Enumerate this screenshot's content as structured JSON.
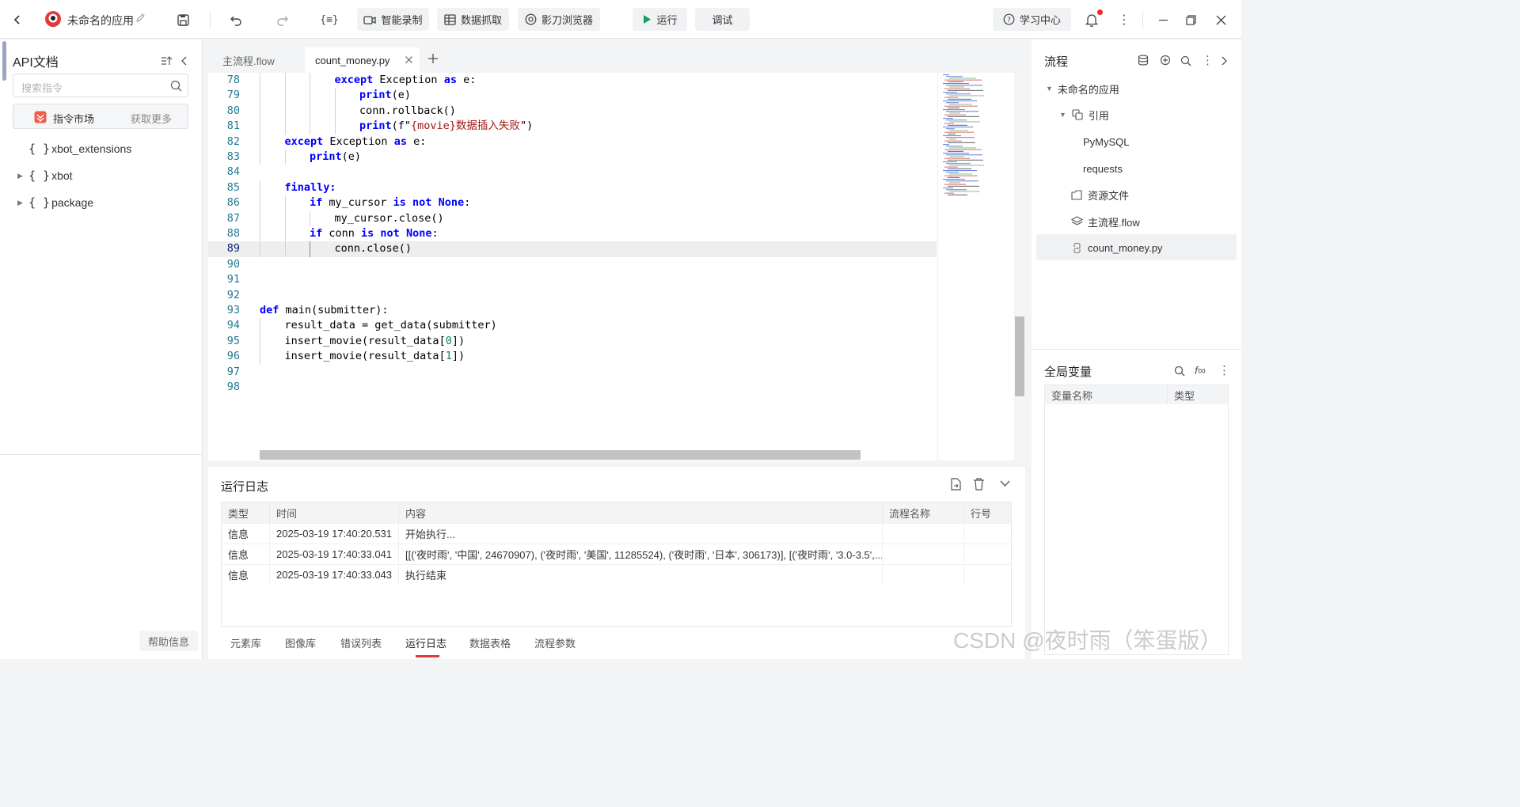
{
  "app": {
    "name": "未命名的应用"
  },
  "toolbar": {
    "smart_record": "智能录制",
    "data_capture": "数据抓取",
    "browser": "影刀浏览器",
    "run": "运行",
    "debug": "调试",
    "learning_center": "学习中心"
  },
  "left": {
    "title": "API文档",
    "search_placeholder": "搜索指令",
    "market_label": "指令市场",
    "market_more": "获取更多",
    "tree": [
      {
        "label": "xbot_extensions"
      },
      {
        "label": "xbot"
      },
      {
        "label": "package"
      }
    ],
    "help": "帮助信息"
  },
  "editor": {
    "tabs": [
      {
        "label": "主流程.flow"
      },
      {
        "label": "count_money.py"
      }
    ],
    "lines": [
      {
        "n": "78",
        "indent": 3,
        "parts": [
          [
            "kw",
            "except"
          ],
          [
            "p",
            " Exception "
          ],
          [
            "kw",
            "as"
          ],
          [
            "p",
            " e:"
          ]
        ]
      },
      {
        "n": "79",
        "indent": 4,
        "parts": [
          [
            "kw",
            "print"
          ],
          [
            "p",
            "(e)"
          ]
        ]
      },
      {
        "n": "80",
        "indent": 4,
        "parts": [
          [
            "p",
            "conn.rollback()"
          ]
        ]
      },
      {
        "n": "81",
        "indent": 4,
        "parts": [
          [
            "kw",
            "print"
          ],
          [
            "p",
            "(f\""
          ],
          [
            "str",
            "{movie}数据插入失败"
          ],
          [
            "p",
            "\")"
          ]
        ]
      },
      {
        "n": "82",
        "indent": 1,
        "parts": [
          [
            "kw",
            "except"
          ],
          [
            "p",
            " Exception "
          ],
          [
            "kw",
            "as"
          ],
          [
            "p",
            " e:"
          ]
        ]
      },
      {
        "n": "83",
        "indent": 2,
        "parts": [
          [
            "kw",
            "print"
          ],
          [
            "p",
            "(e)"
          ]
        ]
      },
      {
        "n": "84",
        "indent": 0,
        "parts": []
      },
      {
        "n": "85",
        "indent": 1,
        "parts": [
          [
            "kw",
            "finally:"
          ]
        ]
      },
      {
        "n": "86",
        "indent": 2,
        "parts": [
          [
            "kw",
            "if"
          ],
          [
            "p",
            " my_cursor "
          ],
          [
            "kw",
            "is not None"
          ],
          [
            "p",
            ":"
          ]
        ]
      },
      {
        "n": "87",
        "indent": 3,
        "parts": [
          [
            "p",
            "my_cursor.close()"
          ]
        ]
      },
      {
        "n": "88",
        "indent": 2,
        "parts": [
          [
            "kw",
            "if"
          ],
          [
            "p",
            " conn "
          ],
          [
            "kw",
            "is not None"
          ],
          [
            "p",
            ":"
          ]
        ]
      },
      {
        "n": "89",
        "indent": 3,
        "parts": [
          [
            "p",
            "conn.close()"
          ]
        ]
      },
      {
        "n": "90",
        "indent": 0,
        "parts": []
      },
      {
        "n": "91",
        "indent": 0,
        "parts": []
      },
      {
        "n": "92",
        "indent": 0,
        "parts": []
      },
      {
        "n": "93",
        "indent": 0,
        "parts": [
          [
            "kw",
            "def"
          ],
          [
            "p",
            " main(submitter):"
          ]
        ]
      },
      {
        "n": "94",
        "indent": 1,
        "parts": [
          [
            "p",
            "result_data = get_data(submitter)"
          ]
        ]
      },
      {
        "n": "95",
        "indent": 1,
        "parts": [
          [
            "p",
            "insert_movie(result_data["
          ],
          [
            "num",
            "0"
          ],
          [
            "p",
            "])"
          ]
        ]
      },
      {
        "n": "96",
        "indent": 1,
        "parts": [
          [
            "p",
            "insert_movie(result_data["
          ],
          [
            "num",
            "1"
          ],
          [
            "p",
            "])"
          ]
        ]
      },
      {
        "n": "97",
        "indent": 0,
        "parts": []
      },
      {
        "n": "98",
        "indent": 0,
        "parts": []
      }
    ],
    "current_line": "89"
  },
  "log": {
    "title": "运行日志",
    "columns": [
      "类型",
      "时间",
      "内容",
      "流程名称",
      "行号"
    ],
    "rows": [
      [
        "信息",
        "2025-03-19 17:40:20.531",
        "开始执行...",
        "",
        ""
      ],
      [
        "信息",
        "2025-03-19 17:40:33.041",
        "[[('夜时雨', '中国', 24670907), ('夜时雨', '美国', 11285524), ('夜时雨', '日本', 306173)], [('夜时雨', '3.0-3.5',...",
        "",
        ""
      ],
      [
        "信息",
        "2025-03-19 17:40:33.043",
        "执行结束",
        "",
        ""
      ]
    ],
    "bottom_tabs": [
      "元素库",
      "图像库",
      "错误列表",
      "运行日志",
      "数据表格",
      "流程参数"
    ],
    "active_tab": "运行日志"
  },
  "right": {
    "flow_title": "流程",
    "tree": {
      "app": "未命名的应用",
      "refs": "引用",
      "ref_items": [
        "PyMySQL",
        "requests"
      ],
      "resources": "资源文件",
      "main_flow": "主流程.flow",
      "py_file": "count_money.py"
    },
    "globals_title": "全局变量",
    "globals_columns": [
      "变量名称",
      "类型"
    ]
  },
  "watermark": "CSDN @夜时雨（笨蛋版）",
  "colors": {
    "accent": "#3370ff",
    "run_green": "#19a15f",
    "code_keyword": "#0000ff",
    "code_string": "#a31515",
    "code_number": "#098658"
  }
}
